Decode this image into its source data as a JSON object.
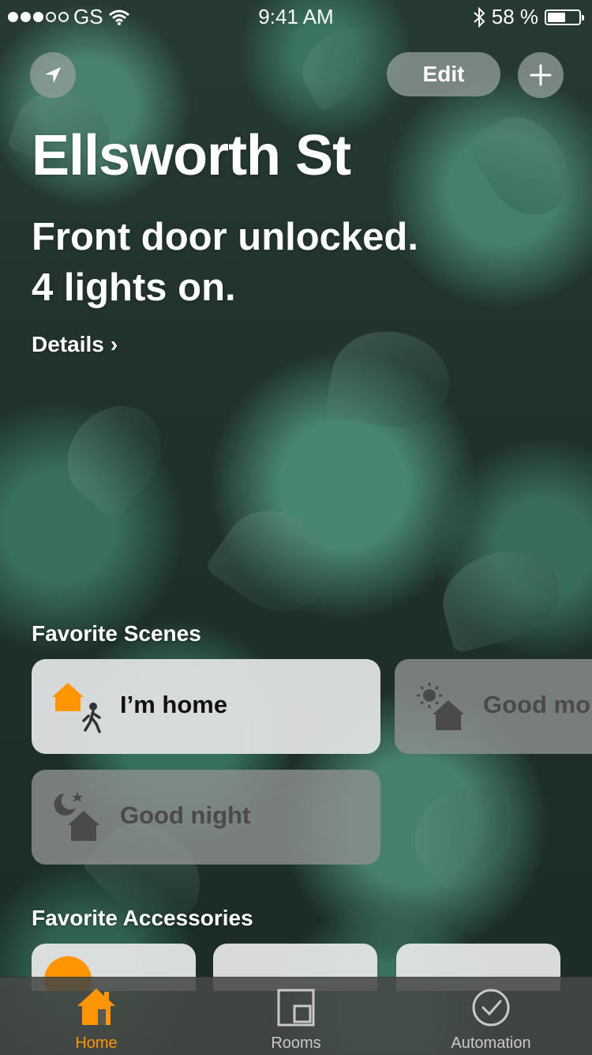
{
  "status_bar": {
    "carrier": "GS",
    "time": "9:41 AM",
    "battery_percent": "58 %",
    "battery_level": 0.58
  },
  "header": {
    "edit_label": "Edit",
    "title": "Ellsworth St",
    "summary_line1": "Front door unlocked.",
    "summary_line2": "4 lights on.",
    "details_label": "Details",
    "details_chevron": "›"
  },
  "favorite_scenes": {
    "title": "Favorite Scenes",
    "items": [
      {
        "label": "I’m home",
        "icon": "home-person-icon",
        "active": true
      },
      {
        "label": "Good mor",
        "icon": "sun-home-icon",
        "active": false
      },
      {
        "label": "Good night",
        "icon": "moon-home-icon",
        "active": false
      }
    ]
  },
  "favorite_accessories": {
    "title": "Favorite Accessories",
    "items": [
      {
        "icon": "orange-orb-icon"
      },
      {
        "icon": ""
      },
      {
        "icon": ""
      }
    ]
  },
  "tab_bar": {
    "tabs": [
      {
        "label": "Home",
        "icon": "home-icon",
        "selected": true
      },
      {
        "label": "Rooms",
        "icon": "rooms-icon",
        "selected": false
      },
      {
        "label": "Automation",
        "icon": "automation-clock-icon",
        "selected": false
      }
    ]
  },
  "colors": {
    "accent": "#ff9500",
    "inactive_tab_label": "#c9c9c9"
  }
}
